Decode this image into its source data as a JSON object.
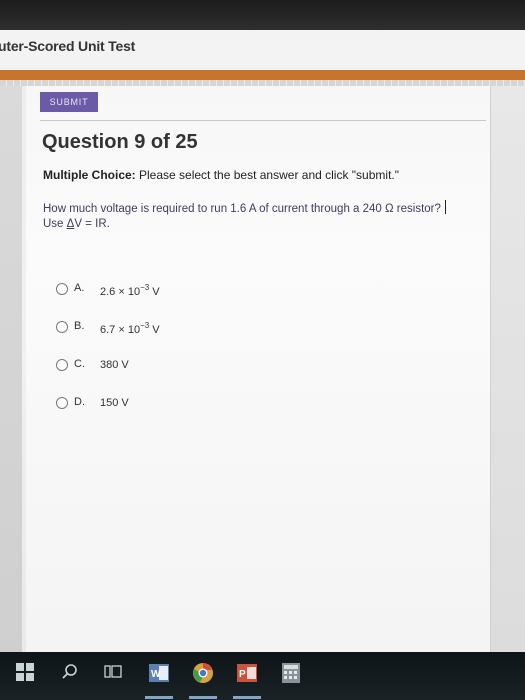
{
  "app": {
    "title": "uter-Scored Unit Test"
  },
  "toolbar": {
    "submit_label": "SUBMIT"
  },
  "question": {
    "title": "Question 9 of 25",
    "instructions_prefix": "Multiple Choice:",
    "instructions_text": "Please select the best answer and click \"submit.\"",
    "prompt_line1": "How much voltage is required to run 1.6 A of current through a 240 Ω resistor?",
    "prompt_use": "Use",
    "prompt_delta": "Δ",
    "prompt_formula": "V = IR."
  },
  "options": [
    {
      "letter": "A.",
      "mantissa": "2.6 × 10",
      "exponent": "−3",
      "unit": " V"
    },
    {
      "letter": "B.",
      "mantissa": "6.7 × 10",
      "exponent": "−3",
      "unit": " V"
    },
    {
      "letter": "C.",
      "mantissa": "380 V",
      "exponent": "",
      "unit": ""
    },
    {
      "letter": "D.",
      "mantissa": "150 V",
      "exponent": "",
      "unit": ""
    }
  ],
  "taskbar": {
    "icons": [
      "windows-start-icon",
      "search-icon",
      "task-view-icon",
      "word-icon",
      "chrome-icon",
      "powerpoint-icon",
      "calculator-icon"
    ]
  },
  "colors": {
    "submit_bg": "#6b5aa6",
    "banner": "#c8742d",
    "taskbar": "#141b1f"
  }
}
